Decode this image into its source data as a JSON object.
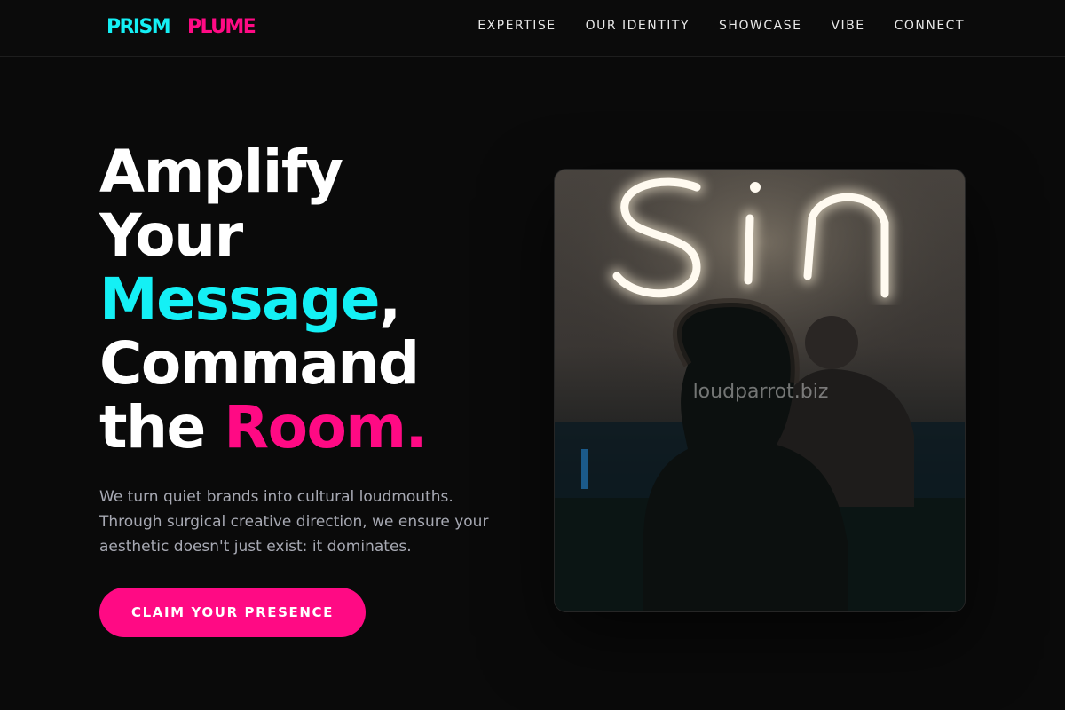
{
  "colors": {
    "cyan": "#14f0f5",
    "pink": "#ff0a84",
    "background": "#0a0a0a"
  },
  "brand": {
    "part1": "PRISM",
    "part2": "PLUME"
  },
  "nav": {
    "items": [
      {
        "label": "EXPERTISE"
      },
      {
        "label": "OUR IDENTITY"
      },
      {
        "label": "SHOWCASE"
      },
      {
        "label": "VIBE"
      },
      {
        "label": "CONNECT"
      }
    ]
  },
  "hero": {
    "line1": "Amplify",
    "line2": "Your",
    "line3_highlight": "Message",
    "line3_punct": ",",
    "line4": "Command",
    "line5_prefix": "the ",
    "line5_highlight": "Room.",
    "description": "We turn quiet brands into cultural loudmouths. Through surgical creative direction, we ensure your aesthetic doesn't just exist: it dominates.",
    "cta_label": "CLAIM YOUR PRESENCE"
  },
  "image": {
    "neon_text": "Sin",
    "watermark": "loudparrot.biz"
  }
}
